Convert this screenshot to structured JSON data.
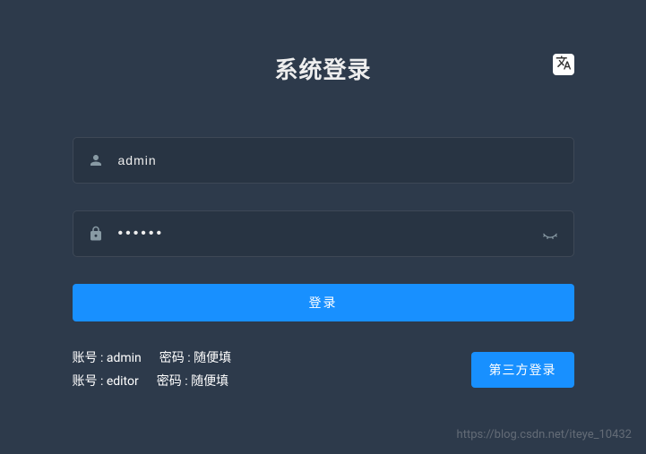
{
  "header": {
    "title": "系统登录"
  },
  "form": {
    "username": {
      "value": "admin",
      "placeholder": ""
    },
    "password": {
      "value": "••••••",
      "placeholder": ""
    },
    "login_button": "登录"
  },
  "hints": {
    "row1": {
      "account": "账号 : admin",
      "password": "密码 : 随便填"
    },
    "row2": {
      "account": "账号 : editor",
      "password": "密码 : 随便填"
    }
  },
  "third_party_button": "第三方登录",
  "watermark": "https://blog.csdn.net/iteye_10432",
  "colors": {
    "background": "#2d3a4b",
    "primary": "#1890ff",
    "text_light": "#eeeeee",
    "icon_muted": "#889aa4"
  }
}
